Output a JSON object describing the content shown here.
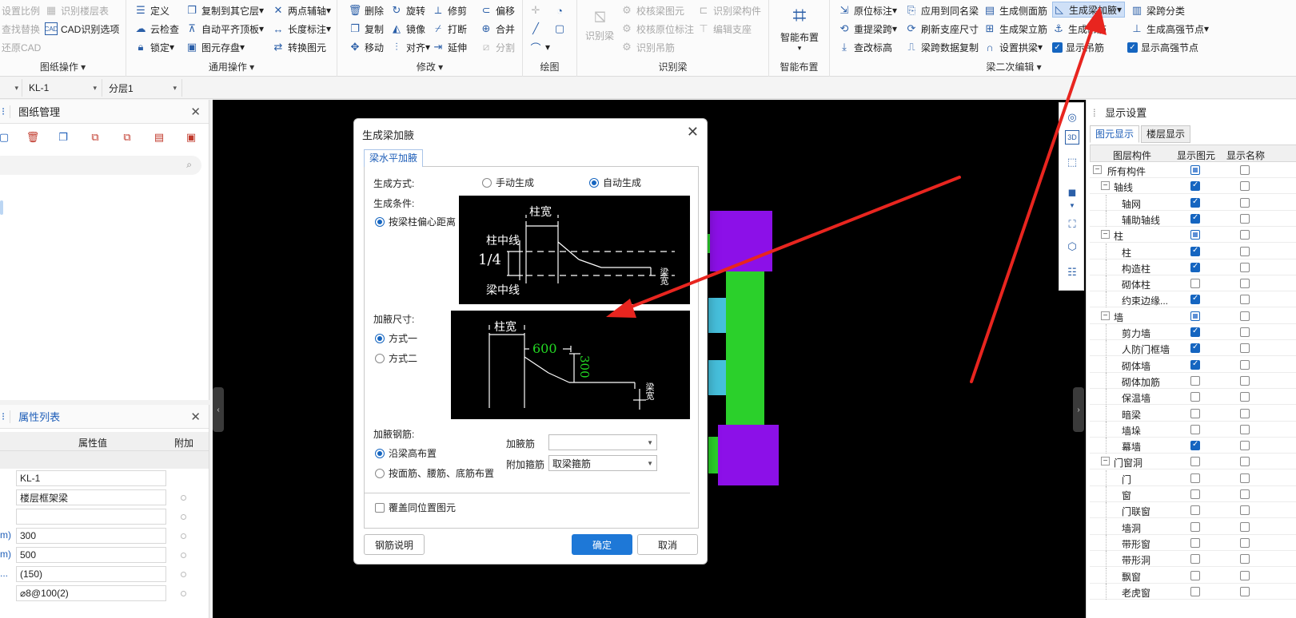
{
  "ribbon": {
    "groups": {
      "drawing_ops": {
        "title": "图纸操作",
        "items": [
          "设置比例",
          "识别楼层表",
          "查找替换",
          "CAD识别选项",
          "还原CAD"
        ]
      },
      "general_ops": {
        "title": "通用操作",
        "items": [
          "定义",
          "复制到其它层",
          "两点辅轴",
          "云检查",
          "自动平齐顶板",
          "长度标注",
          "锁定",
          "图元存盘",
          "转换图元"
        ]
      },
      "modify": {
        "title": "修改",
        "items": [
          "删除",
          "旋转",
          "修剪",
          "偏移",
          "复制",
          "镜像",
          "延伸",
          "合并",
          "移动",
          "打断",
          "对齐",
          "分割"
        ]
      },
      "draw": {
        "title": "绘图"
      },
      "recognize_beam": {
        "title": "识别梁",
        "items": [
          "识别梁",
          "校核梁图元",
          "识别梁构件",
          "校核原位标注",
          "编辑支座",
          "识别吊筋"
        ]
      },
      "smart_layout": {
        "title": "智能布置",
        "button": "智能布置"
      },
      "beam_secondary": {
        "title": "梁二次编辑",
        "items": [
          "原位标注",
          "应用到同名梁",
          "生成侧面筋",
          "生成梁加腋",
          "梁跨分类",
          "重提梁跨",
          "刷新支座尺寸",
          "生成架立筋",
          "生成吊筋",
          "生成高强节点",
          "查改标高",
          "梁跨数据复制",
          "设置拱梁",
          "显示吊筋",
          "显示高强节点"
        ]
      }
    }
  },
  "toolbar2": {
    "element_select": "KL-1",
    "layer_select": "分层1"
  },
  "drawing_panel": {
    "title": "图纸管理"
  },
  "property_panel": {
    "title": "属性列表",
    "col_value": "属性值",
    "col_extra": "附加",
    "rows": [
      {
        "label": "",
        "value": "KL-1"
      },
      {
        "label": "",
        "value": "楼层框架梁"
      },
      {
        "label": "",
        "value": ""
      },
      {
        "label": "m)",
        "value": "300"
      },
      {
        "label": "m)",
        "value": "500"
      },
      {
        "label": "...",
        "value": "(150)"
      },
      {
        "label": "",
        "value": "⌀8@100(2)"
      }
    ]
  },
  "display_panel": {
    "title": "显示设置",
    "tabs": [
      "图元显示",
      "楼层显示"
    ],
    "col_component": "图层构件",
    "col_show": "显示图元",
    "col_name": "显示名称",
    "rows": [
      {
        "label": "所有构件",
        "level": 0,
        "toggle": "−",
        "show": "part"
      },
      {
        "label": "轴线",
        "level": 1,
        "toggle": "−",
        "show": "on"
      },
      {
        "label": "轴网",
        "level": 2,
        "show": "on"
      },
      {
        "label": "辅助轴线",
        "level": 2,
        "show": "on"
      },
      {
        "label": "柱",
        "level": 1,
        "toggle": "−",
        "show": "part"
      },
      {
        "label": "柱",
        "level": 2,
        "show": "on"
      },
      {
        "label": "构造柱",
        "level": 2,
        "show": "on"
      },
      {
        "label": "砌体柱",
        "level": 2,
        "show": "off"
      },
      {
        "label": "约束边缘...",
        "level": 2,
        "show": "on"
      },
      {
        "label": "墙",
        "level": 1,
        "toggle": "−",
        "show": "part"
      },
      {
        "label": "剪力墙",
        "level": 2,
        "show": "on"
      },
      {
        "label": "人防门框墙",
        "level": 2,
        "show": "on"
      },
      {
        "label": "砌体墙",
        "level": 2,
        "show": "on"
      },
      {
        "label": "砌体加筋",
        "level": 2,
        "show": "off"
      },
      {
        "label": "保温墙",
        "level": 2,
        "show": "off"
      },
      {
        "label": "暗梁",
        "level": 2,
        "show": "off"
      },
      {
        "label": "墙垛",
        "level": 2,
        "show": "off"
      },
      {
        "label": "幕墙",
        "level": 2,
        "show": "on"
      },
      {
        "label": "门窗洞",
        "level": 1,
        "toggle": "−",
        "show": "off"
      },
      {
        "label": "门",
        "level": 2,
        "show": "off"
      },
      {
        "label": "窗",
        "level": 2,
        "show": "off"
      },
      {
        "label": "门联窗",
        "level": 2,
        "show": "off"
      },
      {
        "label": "墙洞",
        "level": 2,
        "show": "off"
      },
      {
        "label": "带形窗",
        "level": 2,
        "show": "off"
      },
      {
        "label": "带形洞",
        "level": 2,
        "show": "off"
      },
      {
        "label": "飘窗",
        "level": 2,
        "show": "off"
      },
      {
        "label": "老虎窗",
        "level": 2,
        "show": "off"
      }
    ]
  },
  "dialog": {
    "title": "生成梁加腋",
    "tab": "梁水平加腋",
    "gen_mode_label": "生成方式:",
    "manual": "手动生成",
    "auto": "自动生成",
    "condition_label": "生成条件:",
    "condition_option": "按梁柱偏心距离",
    "diagram1": {
      "col_width": "柱宽",
      "col_center": "柱中线",
      "beam_center": "梁中线",
      "quarter": "1/4",
      "side_text": "梁宽"
    },
    "size_label": "加腋尺寸:",
    "size_mode1": "方式一",
    "size_mode2": "方式二",
    "diagram2": {
      "col_width": "柱宽",
      "length": "600",
      "depth": "300",
      "side_text": "梁宽"
    },
    "rebar_label": "加腋钢筋:",
    "rebar_opt1": "沿梁高布置",
    "rebar_opt2": "按面筋、腰筋、底筋布置",
    "haunch_bar_label": "加腋筋",
    "haunch_bar_value": "",
    "stirrup_label": "附加箍筋",
    "stirrup_value": "取梁箍筋",
    "override_label": "覆盖同位置图元",
    "btn_help": "钢筋说明",
    "btn_ok": "确定",
    "btn_cancel": "取消"
  },
  "colors": {
    "accent": "#1e78d7",
    "arrow": "#e8251f",
    "beam_green": "#2bd02b",
    "column_purple": "#8c10e8",
    "wall_cyan": "#46c0dc"
  }
}
